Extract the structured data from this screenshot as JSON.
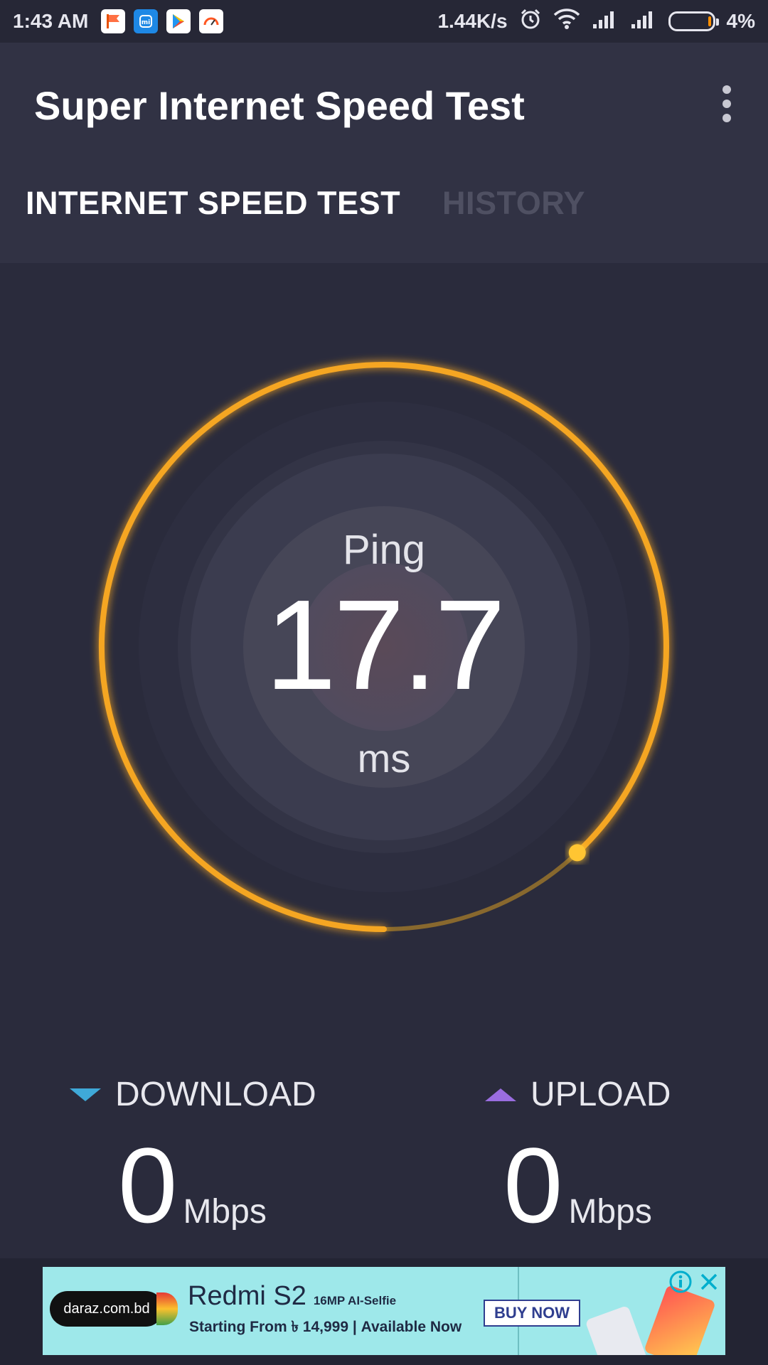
{
  "status_bar": {
    "time": "1:43 AM",
    "net_speed": "1.44K/s",
    "battery": "4%",
    "icons": [
      "notification-flag-icon",
      "mi-app-icon",
      "play-store-icon",
      "speedtest-app-icon",
      "alarm-icon",
      "wifi-icon",
      "signal-1-icon",
      "signal-2-icon",
      "battery-icon"
    ]
  },
  "app_bar": {
    "title": "Super Internet Speed Test",
    "menu_icon": "more-vert-icon"
  },
  "tabs": [
    {
      "label": "INTERNET SPEED TEST",
      "active": true
    },
    {
      "label": "HISTORY",
      "active": false
    }
  ],
  "gauge": {
    "label": "Ping",
    "value": "17.7",
    "unit": "ms",
    "progress": 0.88,
    "accent": "#f5a623"
  },
  "download": {
    "label": "DOWNLOAD",
    "value": "0",
    "unit": "Mbps",
    "color": "#3fa9d8"
  },
  "upload": {
    "label": "UPLOAD",
    "value": "0",
    "unit": "Mbps",
    "color": "#9a6de0"
  },
  "ad": {
    "brand": "daraz.com.bd",
    "headline": "Redmi S2",
    "headline_sub": "16MP AI-Selfie",
    "subtext": "Starting From ৳ 14,999 | Available Now",
    "cta": "BUY NOW"
  }
}
